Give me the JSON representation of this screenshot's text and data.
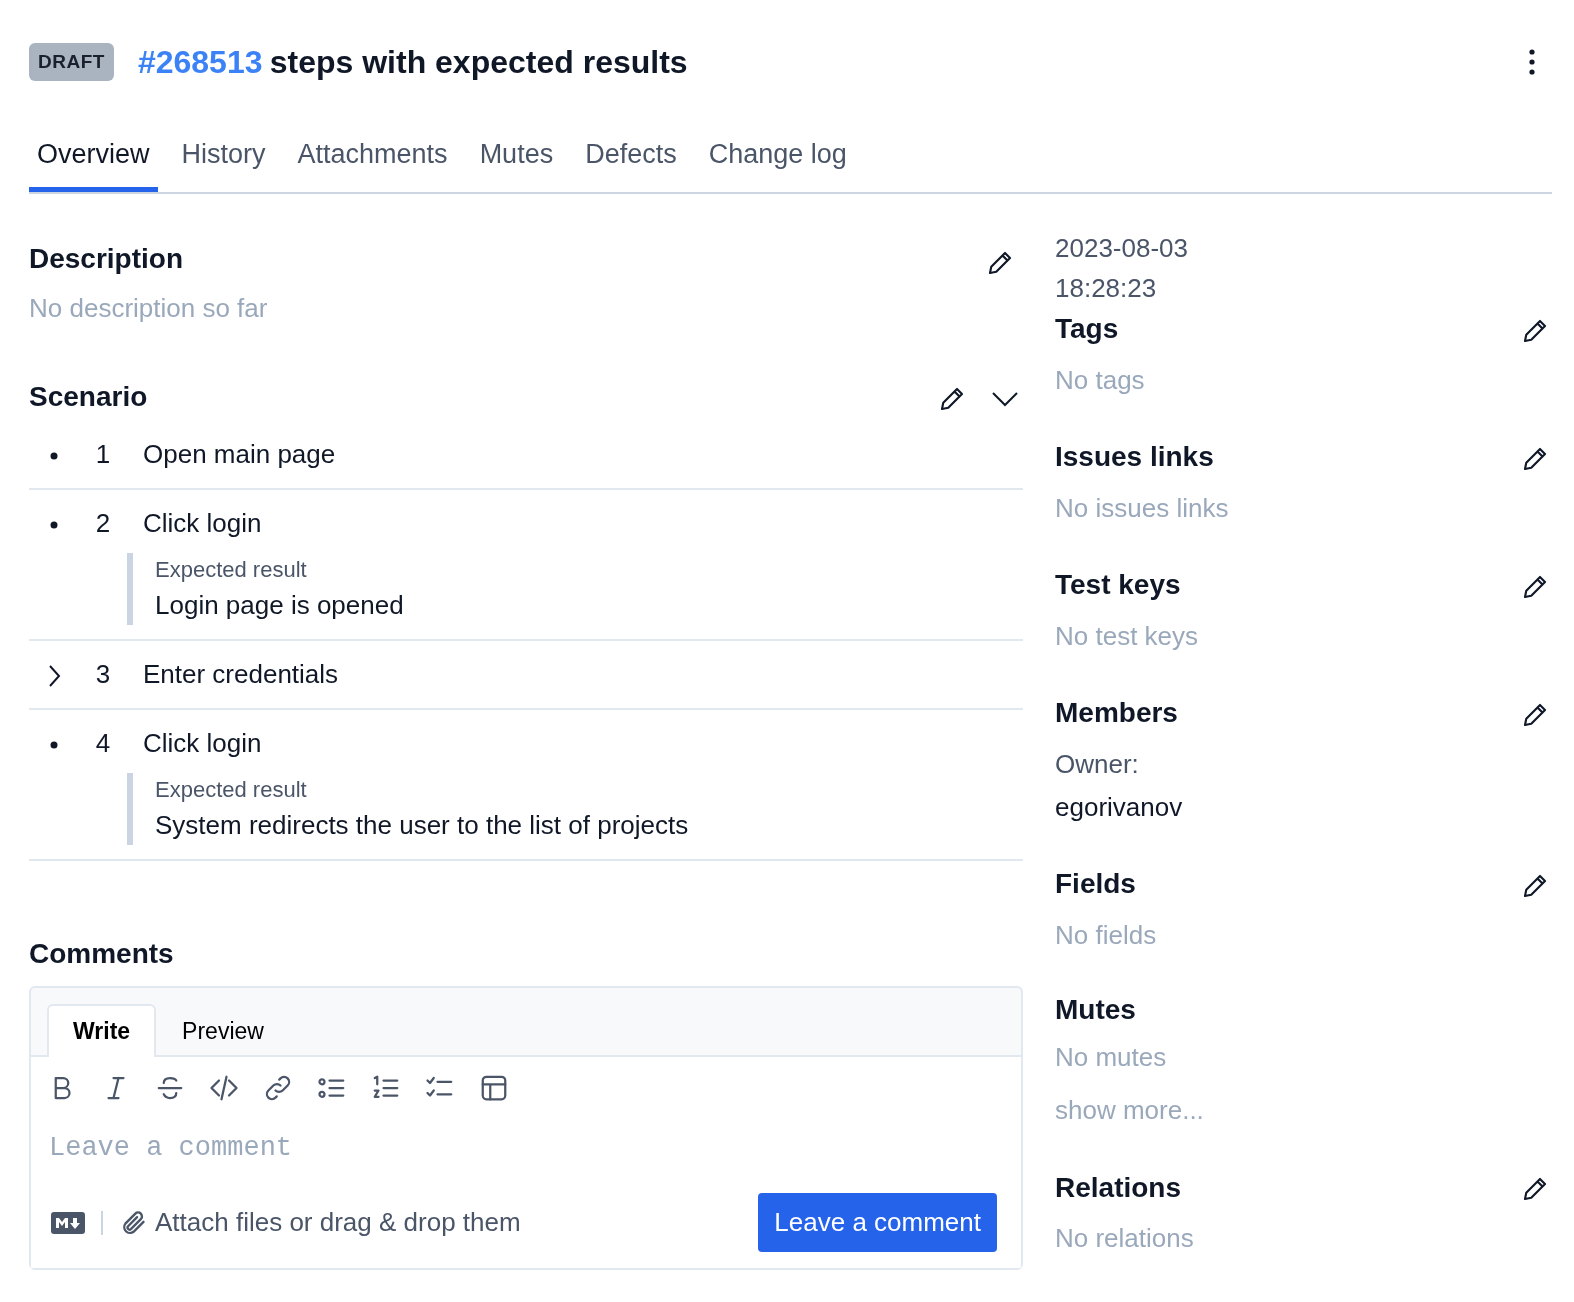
{
  "header": {
    "status": "DRAFT",
    "id": "#268513",
    "title": "steps with expected results"
  },
  "tabs": [
    {
      "label": "Overview",
      "selected": true
    },
    {
      "label": "History",
      "selected": false
    },
    {
      "label": "Attachments",
      "selected": false
    },
    {
      "label": "Mutes",
      "selected": false
    },
    {
      "label": "Defects",
      "selected": false
    },
    {
      "label": "Change log",
      "selected": false
    }
  ],
  "description": {
    "title": "Description",
    "text": "No description so far"
  },
  "scenario": {
    "title": "Scenario",
    "expanded": true,
    "steps": [
      {
        "kind": "leaf",
        "number": "1",
        "text": "Open main page"
      },
      {
        "kind": "leaf",
        "number": "2",
        "text": "Click login",
        "expected_label": "Expected result",
        "expected": "Login page is opened"
      },
      {
        "kind": "group",
        "expanded": false,
        "number": "3",
        "text": "Enter credentials"
      },
      {
        "kind": "leaf",
        "number": "4",
        "text": "Click login",
        "expected_label": "Expected result",
        "expected": "System redirects the user to the list of projects"
      }
    ]
  },
  "comments": {
    "title": "Comments",
    "tabs": [
      {
        "label": "Write",
        "selected": true
      },
      {
        "label": "Preview",
        "selected": false
      }
    ],
    "placeholder": "Leave a comment",
    "attach": "Attach files or drag & drop them",
    "submit": "Leave a comment"
  },
  "sidebar": {
    "date": "2023-08-03 18:28:23",
    "sections": [
      {
        "title": "Tags",
        "editable": true,
        "muted": true,
        "lines": [
          "No tags"
        ]
      },
      {
        "title": "Issues links",
        "editable": true,
        "muted": true,
        "lines": [
          "No issues links"
        ]
      },
      {
        "title": "Test keys",
        "editable": true,
        "muted": true,
        "lines": [
          "No test keys"
        ]
      },
      {
        "title": "Members",
        "editable": true,
        "muted": false,
        "lines": [
          "Owner:",
          "egorivanov"
        ]
      },
      {
        "title": "Fields",
        "editable": true,
        "muted": true,
        "lines": [
          "No fields"
        ]
      },
      {
        "title": "Mutes",
        "editable": false,
        "muted": true,
        "lines": [
          "No mutes"
        ],
        "link": "show more..."
      },
      {
        "title": "Relations",
        "editable": true,
        "muted": true,
        "lines": [
          "No relations"
        ]
      }
    ]
  }
}
